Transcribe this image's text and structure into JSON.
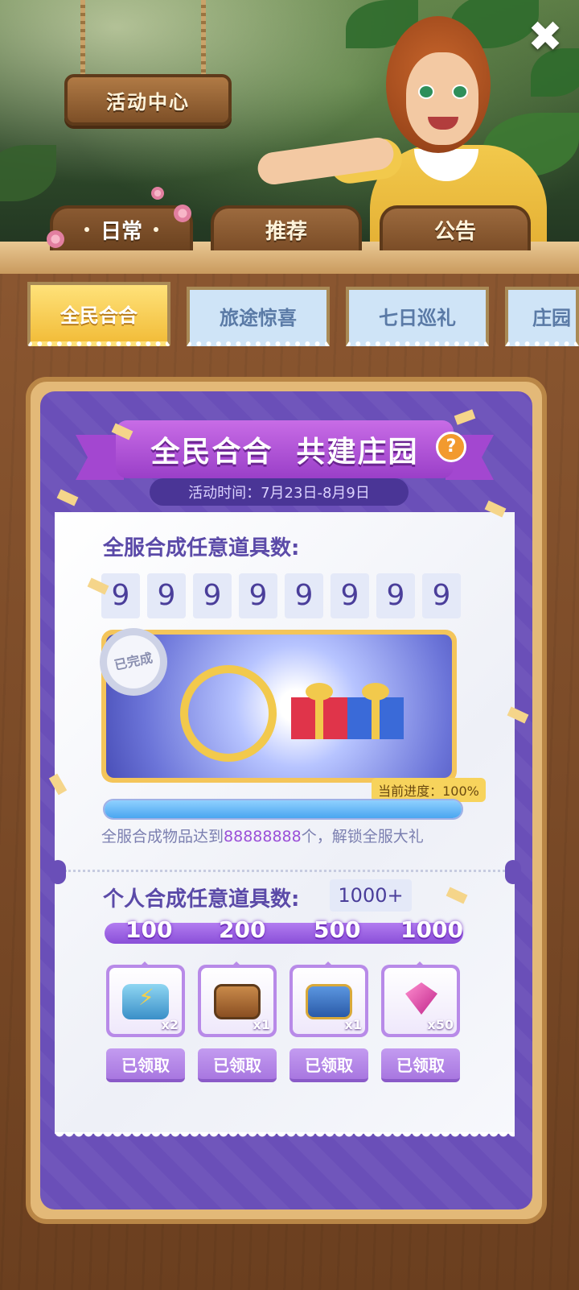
{
  "header": {
    "sign_title": "活动中心",
    "close_label": "✖"
  },
  "main_tabs": [
    {
      "label": "日常",
      "active": true
    },
    {
      "label": "推荐",
      "active": false
    },
    {
      "label": "公告",
      "active": false
    }
  ],
  "sub_tabs": [
    {
      "label": "全民合合",
      "active": true
    },
    {
      "label": "旅途惊喜",
      "active": false
    },
    {
      "label": "七日巡礼",
      "active": false
    },
    {
      "label": "庄园",
      "active": false
    }
  ],
  "event": {
    "title": "全民合合  共建庄园",
    "help_label": "?",
    "time_label": "活动时间：7月23日-8月9日",
    "server_section_title": "全服合成任意道具数:",
    "server_digits": [
      "9",
      "9",
      "9",
      "9",
      "9",
      "9",
      "9",
      "9"
    ],
    "completed_badge": "已完成",
    "progress_label": "当前进度：100%",
    "progress_value": 1.0,
    "unlock_prefix": "全服合成物品达到",
    "unlock_number": "88888888",
    "unlock_suffix": "个，解锁全服大礼",
    "personal_section_title": "个人合成任意道具数:",
    "personal_count": "1000+",
    "milestones": [
      {
        "threshold": "100",
        "reward_icon": "lightning-chest-icon",
        "count": "x2",
        "button": "已领取"
      },
      {
        "threshold": "200",
        "reward_icon": "wooden-chest-icon",
        "count": "x1",
        "button": "已领取"
      },
      {
        "threshold": "500",
        "reward_icon": "blue-chest-icon",
        "count": "x1",
        "button": "已领取"
      },
      {
        "threshold": "1000",
        "reward_icon": "gem-icon",
        "count": "x50",
        "button": "已领取"
      }
    ]
  },
  "colors": {
    "panel_purple": "#6a4fb8",
    "ribbon_purple": "#b45ade",
    "active_tab_gold": "#f2bd3a",
    "progress_blue": "#4aa6f0"
  }
}
